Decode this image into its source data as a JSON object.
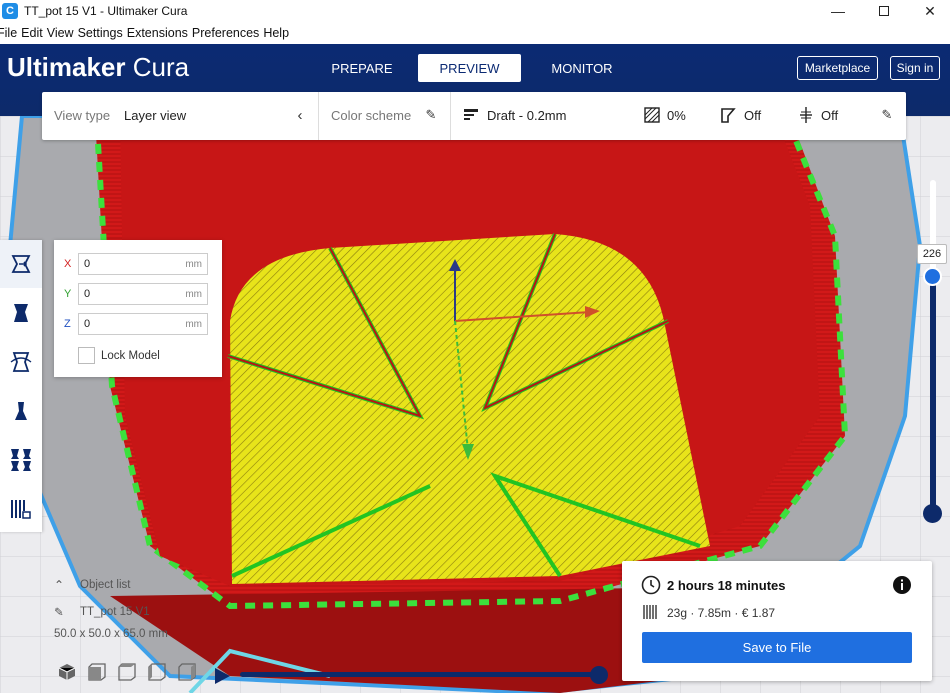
{
  "window": {
    "app_icon": "C",
    "title": "TT_pot 15 V1  - Ultimaker Cura",
    "minimize": "—",
    "close": "✕"
  },
  "menu": [
    "File",
    "Edit",
    "View",
    "Settings",
    "Extensions",
    "Preferences",
    "Help"
  ],
  "header": {
    "brand_bold": "Ultimaker",
    "brand_light": "Cura",
    "tabs": [
      {
        "label": "PREPARE",
        "active": false
      },
      {
        "label": "PREVIEW",
        "active": true
      },
      {
        "label": "MONITOR",
        "active": false
      }
    ],
    "marketplace": "Marketplace",
    "signin": "Sign in"
  },
  "toolbar": {
    "view_type_label": "View type",
    "view_type_value": "Layer view",
    "color_scheme_label": "Color scheme",
    "profile": "Draft - 0.2mm",
    "infill": "0%",
    "support": "Off",
    "adhesion": "Off"
  },
  "move_panel": {
    "x_label": "X",
    "x_value": "0",
    "y_label": "Y",
    "y_value": "0",
    "z_label": "Z",
    "z_value": "0",
    "unit": "mm",
    "lock_label": "Lock Model"
  },
  "object_list": {
    "header": "Object list",
    "name": "TT_pot 15 V1",
    "dimensions": "50.0 x 50.0 x 65.0 mm"
  },
  "layer_slider": {
    "current_layer": "226"
  },
  "print_info": {
    "time": "2 hours 18 minutes",
    "details": "23g · 7.85m · € 1.87",
    "save_label": "Save to File"
  },
  "colors": {
    "header_bg": "#0d2a6a",
    "accent": "#1f6fe0",
    "wall": "#d01b1b",
    "infill": "#e8e41a",
    "inner_wall": "#3ce03c"
  }
}
